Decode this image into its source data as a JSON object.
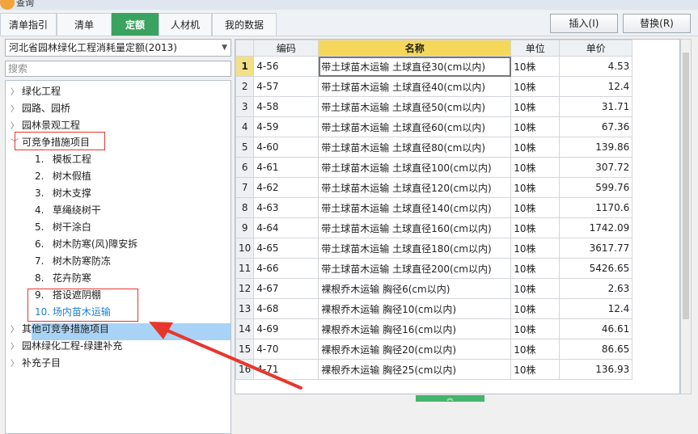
{
  "window": {
    "title": "查询"
  },
  "tabs": [
    {
      "label": "清单指引",
      "active": false
    },
    {
      "label": "清单",
      "active": false
    },
    {
      "label": "定额",
      "active": true
    },
    {
      "label": "人材机",
      "active": false
    },
    {
      "label": "我的数据",
      "active": false
    }
  ],
  "buttons": {
    "insert": "插入(I)",
    "replace": "替换(R)"
  },
  "quota_selector": {
    "value": "河北省园林绿化工程消耗量定额(2013)"
  },
  "search": {
    "placeholder": "搜索"
  },
  "tree": {
    "top_items": [
      "绿化工程",
      "园路、园桥",
      "园林景观工程"
    ],
    "expanded": "可竞争措施项目",
    "children": [
      {
        "num": "1.",
        "label": "模板工程"
      },
      {
        "num": "2.",
        "label": "树木假植"
      },
      {
        "num": "3.",
        "label": "树木支撑"
      },
      {
        "num": "4.",
        "label": "草绳绕树干"
      },
      {
        "num": "5.",
        "label": "树干涂白"
      },
      {
        "num": "6.",
        "label": "树木防寒(风)障安拆"
      },
      {
        "num": "7.",
        "label": "树木防寒防冻"
      },
      {
        "num": "8.",
        "label": "花卉防寒"
      },
      {
        "num": "9.",
        "label": "搭设遮阴棚"
      },
      {
        "num": "10.",
        "label": "场内苗木运输"
      }
    ],
    "bottom_items": [
      "其他可竞争措施项目",
      "园林绿化工程-绿建补充",
      "补充子目"
    ]
  },
  "grid": {
    "headers": [
      "编码",
      "名称",
      "单位",
      "单价"
    ],
    "rows": [
      {
        "n": "1",
        "code": "4-56",
        "name": "带土球苗木运输 土球直径30(cm以内)",
        "unit": "10株",
        "price": "4.53"
      },
      {
        "n": "2",
        "code": "4-57",
        "name": "带土球苗木运输 土球直径40(cm以内)",
        "unit": "10株",
        "price": "12.4"
      },
      {
        "n": "3",
        "code": "4-58",
        "name": "带土球苗木运输 土球直径50(cm以内)",
        "unit": "10株",
        "price": "31.71"
      },
      {
        "n": "4",
        "code": "4-59",
        "name": "带土球苗木运输 土球直径60(cm以内)",
        "unit": "10株",
        "price": "67.36"
      },
      {
        "n": "5",
        "code": "4-60",
        "name": "带土球苗木运输 土球直径80(cm以内)",
        "unit": "10株",
        "price": "139.86"
      },
      {
        "n": "6",
        "code": "4-61",
        "name": "带土球苗木运输 土球直径100(cm以内)",
        "unit": "10株",
        "price": "307.72"
      },
      {
        "n": "7",
        "code": "4-62",
        "name": "带土球苗木运输 土球直径120(cm以内)",
        "unit": "10株",
        "price": "599.76"
      },
      {
        "n": "8",
        "code": "4-63",
        "name": "带土球苗木运输 土球直径140(cm以内)",
        "unit": "10株",
        "price": "1170.6"
      },
      {
        "n": "9",
        "code": "4-64",
        "name": "带土球苗木运输 土球直径160(cm以内)",
        "unit": "10株",
        "price": "1742.09"
      },
      {
        "n": "10",
        "code": "4-65",
        "name": "带土球苗木运输 土球直径180(cm以内)",
        "unit": "10株",
        "price": "3617.77"
      },
      {
        "n": "11",
        "code": "4-66",
        "name": "带土球苗木运输 土球直径200(cm以内)",
        "unit": "10株",
        "price": "5426.65"
      },
      {
        "n": "12",
        "code": "4-67",
        "name": "裸根乔木运输 胸径6(cm以内)",
        "unit": "10株",
        "price": "2.63"
      },
      {
        "n": "13",
        "code": "4-68",
        "name": "裸根乔木运输 胸径10(cm以内)",
        "unit": "10株",
        "price": "12.4"
      },
      {
        "n": "14",
        "code": "4-69",
        "name": "裸根乔木运输 胸径16(cm以内)",
        "unit": "10株",
        "price": "46.61"
      },
      {
        "n": "15",
        "code": "4-70",
        "name": "裸根乔木运输 胸径20(cm以内)",
        "unit": "10株",
        "price": "86.65"
      },
      {
        "n": "16",
        "code": "4-71",
        "name": "裸根乔木运输 胸径25(cm以内)",
        "unit": "10株",
        "price": "136.93"
      }
    ]
  },
  "colors": {
    "accent": "#3aa35f",
    "annotation": "#e8362c",
    "selection": "#a9d3f6",
    "name_header": "#f5d85a"
  }
}
